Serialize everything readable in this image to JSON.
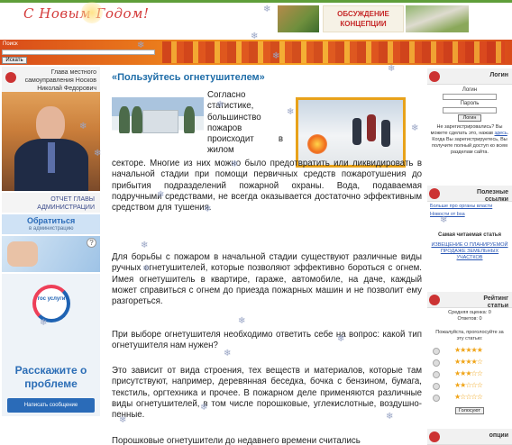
{
  "header": {
    "greeting": "С Новым Годом!",
    "discuss_banner": "ОБСУЖДЕНИЕ КОНЦЕПЦИИ"
  },
  "search": {
    "label": "Поиск",
    "placeholder": "",
    "button": "Искать"
  },
  "left": {
    "head_title": "Глава местного самоуправления Носков Николай Федорович",
    "report": "ОТЧЕТ ГЛАВЫ АДМИНИСТРАЦИИ",
    "appeal_title": "Обратиться",
    "appeal_sub": "в администрацию",
    "help_glyph": "?",
    "gos_logo": "гос услуги",
    "gos_big": "Расскажите о проблеме",
    "gos_button": "Написать сообщение"
  },
  "article": {
    "title": "«Пользуйтесь огнетушителем»",
    "intro": "Согласно статистике, большинство пожаров происходит в жилом",
    "p1": "секторе. Многие из них можно было предотвратить или ликвидировать в начальной стадии при помощи первичных средств пожаротушения до прибытия подразделений пожарной охраны. Вода, подаваемая подручными средствами, не всегда оказывается достаточно эффективным средством для тушения.",
    "p2": "Для борьбы с пожаром в начальной стадии существуют различные виды ручных огнетушителей, которые позволяют эффективно бороться с огнем. Имея огнетушитель в квартире, гараже, автомобиле, на даче, каждый может справиться с огнем до приезда пожарных машин и не позволит ему разгореться.",
    "p3": "При выборе огнетушителя необходимо ответить себе на вопрос: какой тип огнетушителя нам нужен?",
    "p4": "Это зависит от вида строения, тех веществ и материалов, которые там присутствуют, например, деревянная беседка, бочка с бензином, бумага, текстиль, оргтехника и прочее. В пожарном деле применяются различные виды огнетушителей, в том числе порошковые, углекислотные, воздушно-пенные.",
    "p5": "Порошковые огнетушители до недавнего времени считались"
  },
  "right": {
    "login_title": "Логин",
    "login_label": "Логин",
    "password_label": "Пароль",
    "login_button": "Логин",
    "login_note_1": "Не зарегистрировались? Вы можете сделать это, нажав",
    "login_note_link": "здесь",
    "login_note_2": ". Когда Вы зарегистрируетесь, Вы получите полный доступ ко всем разделам сайта.",
    "links_title": "Полезные ссылки",
    "link1": "Больше про органы власти",
    "link2": "Новости от bsa",
    "most_read_title": "Самая читаемая статья",
    "most_read_link": "ИЗВЕЩЕНИЕ О ПЛАНИРУЕМОЙ ПРОДАЖЕ ЗЕМЕЛЬНЫХ УЧАСТКОВ",
    "rating_title": "Рейтинг статьи",
    "avg_rating": "Средняя оценка: 0",
    "votes": "Ответов: 0",
    "vote_prompt": "Пожалуйста, проголосуйте за эту статью:",
    "vote_button": "Голосуют",
    "bottom_title": "опции",
    "star_rows": [
      "★★★★★",
      "★★★★☆",
      "★★★☆☆",
      "★★☆☆☆",
      "★☆☆☆☆"
    ]
  }
}
